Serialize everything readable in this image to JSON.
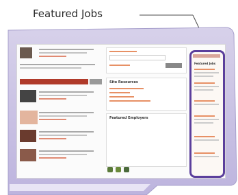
{
  "callout": {
    "label": "Featured Jobs"
  },
  "screenshot": {
    "middle_sections": [
      "Site Resources",
      "Featured Employers"
    ],
    "right_panel_heading": "Featured Jobs"
  },
  "colors": {
    "frame": "#5b3f9c",
    "accent": "#b03a2a",
    "link": "#e08a73"
  }
}
